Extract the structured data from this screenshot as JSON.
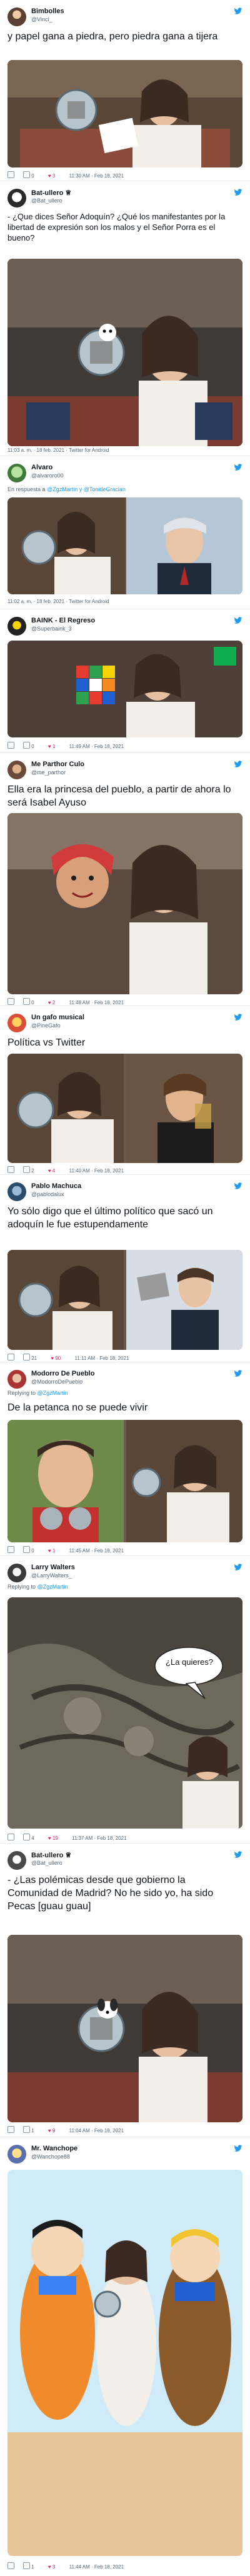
{
  "tweets": [
    {
      "name": "Bimbolles",
      "handle": "@Vinci_",
      "text": "y papel gana a piedra, pero piedra gana a tijera",
      "meta": "11:30 AM · Feb 18, 2021",
      "likes": "3",
      "retweets": "0"
    },
    {
      "name": "Bat-ullero ♕",
      "handle": "@Bat_ullero",
      "text": "- ¿Que dices Señor Adoquín? ¿Qué los manifestantes por la libertad de expresión son los malos y el Señor Porra es el bueno?",
      "meta": "11:03 a. m. · 18 feb. 2021 · Twitter for Android"
    },
    {
      "name": "Alvaro",
      "handle": "@alvaroro00",
      "reply_prefix": "En respuesta a",
      "reply_to": "@ZgzMartin y @TonideGracian",
      "meta": "11:02 a. m. · 18 feb. 2021 · Twitter for Android"
    },
    {
      "name": "BAINK - El Regreso",
      "handle": "@Superbaink_3",
      "meta": "11:49 AM · Feb 18, 2021",
      "likes": "1",
      "retweets": "0"
    },
    {
      "name": "Me Parthor Culo",
      "handle": "@me_parthor",
      "text": "Ella era la princesa del pueblo, a partir de ahora lo será Isabel Ayuso",
      "meta": "11:48 AM · Feb 18, 2021",
      "likes": "2",
      "retweets": "0"
    },
    {
      "name": "Un gafo musical",
      "handle": "@PineGafo",
      "text": "Política vs Twitter",
      "meta": "11:40 AM · Feb 18, 2021",
      "likes": "4",
      "retweets": "2"
    },
    {
      "name": "Pablo Machuca",
      "handle": "@pablodalux",
      "text": "Yo sólo digo que el último político que sacó un adoquín le fue estupendamente",
      "meta": "11:11 AM · Feb 18, 2021",
      "likes": "90",
      "retweets": "21"
    },
    {
      "name": "Modorro De Pueblo",
      "handle": "@ModorroDePueblo",
      "reply_prefix": "Replying to",
      "reply_to": "@ZgzMartin",
      "text": "De la petanca no se puede vivir",
      "meta": "11:45 AM · Feb 18, 2021",
      "likes": "1",
      "retweets": "0"
    },
    {
      "name": "Larry Walters",
      "handle": "@LarryWalters_",
      "reply_prefix": "Replying to",
      "reply_to": "@ZgzMartin",
      "bubble": "¿La quieres?",
      "meta": "11:37 AM · Feb 18, 2021",
      "likes": "19",
      "retweets": "4"
    },
    {
      "name": "Bat-ullero ♕",
      "handle": "@Bat_ullero",
      "text": "- ¿Las polémicas desde que gobierno la Comunidad de Madrid? No he sido yo, ha sido Pecas [guau guau]",
      "meta": "11:04 AM · Feb 18, 2021",
      "likes": "9",
      "retweets": "1"
    },
    {
      "name": "Mr. Wanchope",
      "handle": "@Wanchope88",
      "meta": "11:44 AM · Feb 18, 2021",
      "likes": "3",
      "retweets": "1"
    }
  ],
  "colors": {
    "twitter_blue": "#1d9bf0",
    "meta_gray": "#536471"
  },
  "icons": [
    "twitter-bird-icon",
    "reply-icon",
    "retweet-icon",
    "heart-icon"
  ]
}
